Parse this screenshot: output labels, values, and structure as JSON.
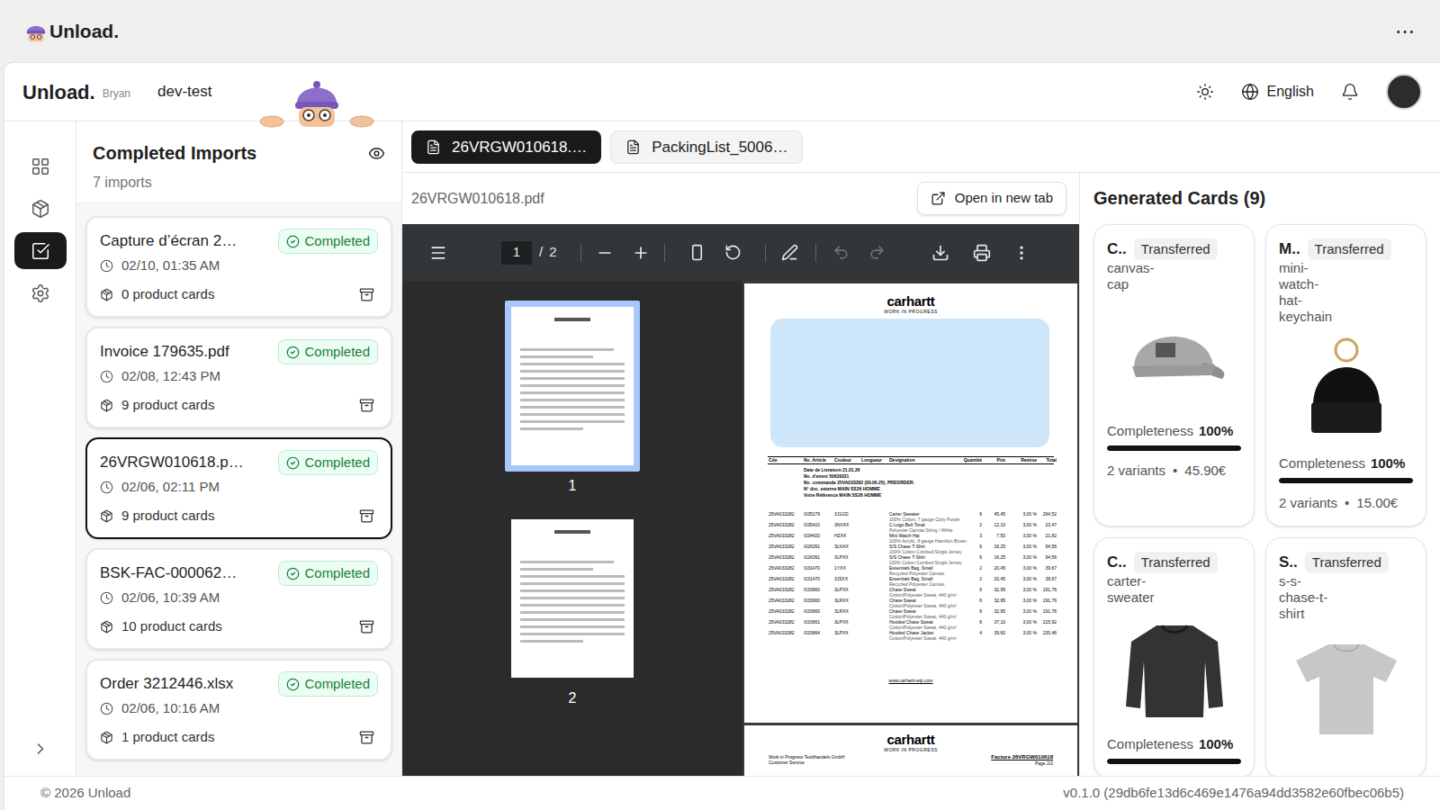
{
  "app_bar": {
    "title": "Unload.",
    "menu": "⋯"
  },
  "header": {
    "brand": "Unload.",
    "user": "Bryan",
    "workspace": "dev-test",
    "language": "English"
  },
  "nav_rail": {
    "items": [
      {
        "kind": "dashboard",
        "selected": false
      },
      {
        "kind": "products",
        "selected": false
      },
      {
        "kind": "imports",
        "selected": true
      },
      {
        "kind": "settings",
        "selected": false
      }
    ]
  },
  "imports_panel": {
    "title": "Completed Imports",
    "count": "7 imports",
    "items": [
      {
        "name": "Capture d’écran 2…",
        "status": "Completed",
        "time": "02/10, 01:35 AM",
        "cards": "0 product cards",
        "selected": false
      },
      {
        "name": "Invoice 179635.pdf",
        "status": "Completed",
        "time": "02/08, 12:43 PM",
        "cards": "9 product cards",
        "selected": false
      },
      {
        "name": "26VRGW010618.p…",
        "status": "Completed",
        "time": "02/06, 02:11 PM",
        "cards": "9 product cards",
        "selected": true
      },
      {
        "name": "BSK-FAC-000062…",
        "status": "Completed",
        "time": "02/06, 10:39 AM",
        "cards": "10 product cards",
        "selected": false
      },
      {
        "name": "Order 3212446.xlsx",
        "status": "Completed",
        "time": "02/06, 10:16 AM",
        "cards": "1 product cards",
        "selected": false
      }
    ]
  },
  "file_tabs": [
    {
      "label": "26VRGW010618.…",
      "selected": true
    },
    {
      "label": "PackingList_5006…",
      "selected": false
    }
  ],
  "document": {
    "filename": "26VRGW010618.pdf",
    "open_button": "Open in new tab"
  },
  "pdf_viewer": {
    "toolbar": {
      "page": "1",
      "separator": "/",
      "page_total": "2",
      "undo_disabled": true,
      "redo_disabled": true
    },
    "thumbnails": [
      {
        "label": "1",
        "selected": true
      },
      {
        "label": "2",
        "selected": false
      }
    ],
    "page1": {
      "logo": "carhartt",
      "tagline": "WORK IN PROGRESS",
      "columns": [
        "Cde",
        "No. Article",
        "Couleur",
        "Longueur",
        "Désignation",
        "Quantité",
        "Prix",
        "Remise",
        "Total"
      ],
      "info": [
        "Date de Livraison 21.01.26",
        "No. d'envoi 50629321",
        "No. commande 25VA033282 (30.06.25), PREORDER:",
        "N° doc. externe MAIN SS26 HOMME",
        "Votre Référence MAIN SS26 HOMME"
      ],
      "rows": [
        {
          "cells": [
            "25VA033282",
            "I035179",
            "3J1GD",
            "",
            "Carter Sweater",
            "6",
            "45,45",
            "3,00 %",
            "264,52"
          ],
          "detail": "100% Cotton, 7 gauge Cozy Purple"
        },
        {
          "cells": [
            "25VA033282",
            "I035410",
            "3NVXX",
            "",
            "C-Logo Belt Tonal",
            "2",
            "12,10",
            "3,00 %",
            "23,47"
          ],
          "detail": "Polyester Canvas String / White"
        },
        {
          "cells": [
            "25VA033282",
            "I034420",
            "HZXX",
            "",
            "Mini Watch Hat",
            "3",
            "7,50",
            "3,00 %",
            "21,82"
          ],
          "detail": "100% Acrylic, 8 gauge Hamilton Brown"
        },
        {
          "cells": [
            "25VA033282",
            "I026391",
            "3LNXX",
            "",
            "S/S Chase T-Shirt",
            "6",
            "16,25",
            "3,00 %",
            "94,56"
          ],
          "detail": "100% Cotton Combed Single Jersey"
        },
        {
          "cells": [
            "25VA033282",
            "I026391",
            "3LPXX",
            "",
            "S/S Chase T-Shirt",
            "6",
            "16,25",
            "3,00 %",
            "94,56"
          ],
          "detail": "100% Cotton Combed Single Jersey"
        },
        {
          "cells": [
            "25VA033282",
            "I031470",
            "1YXX",
            "",
            "Essentials Bag, Small",
            "2",
            "20,45",
            "3,00 %",
            "39,67"
          ],
          "detail": "Recycled Polyester Canvas"
        },
        {
          "cells": [
            "25VA033282",
            "I031470",
            "3JSXX",
            "",
            "Essentials Bag, Small",
            "2",
            "20,45",
            "3,00 %",
            "39,67"
          ],
          "detail": "Recycled Polyester Canvas"
        },
        {
          "cells": [
            "25VA033282",
            "I033660",
            "3LPXX",
            "",
            "Chase Sweat",
            "6",
            "32,95",
            "3,00 %",
            "191,76"
          ],
          "detail": "Cotton/Polyester Sweat, 440 g/m²"
        },
        {
          "cells": [
            "25VA033282",
            "I033660",
            "3LRXX",
            "",
            "Chase Sweat",
            "6",
            "32,95",
            "3,00 %",
            "191,76"
          ],
          "detail": "Cotton/Polyester Sweat, 440 g/m²"
        },
        {
          "cells": [
            "25VA033282",
            "I033660",
            "3LRXX",
            "",
            "Chase Sweat",
            "6",
            "32,95",
            "3,00 %",
            "191,76"
          ],
          "detail": "Cotton/Polyester Sweat, 440 g/m²"
        },
        {
          "cells": [
            "25VA033282",
            "I033661",
            "3LPXX",
            "",
            "Hooded Chase Sweat",
            "6",
            "37,10",
            "3,00 %",
            "215,92"
          ],
          "detail": "Cotton/Polyester Sweat, 440 g/m²"
        },
        {
          "cells": [
            "25VA033282",
            "I033664",
            "3LPXX",
            "",
            "Hooded Chase Jacket",
            "4",
            "39,60",
            "3,00 %",
            "230,46"
          ],
          "detail": "Cotton/Polyester Sweat, 440 g/m²"
        }
      ],
      "footer": "www.carhartt-wip.com"
    },
    "page2": {
      "logo": "carhartt",
      "tagline": "WORK IN PROGRESS",
      "left_lines": [
        "Work in Progress Textilhandels GmbH",
        "Customer Service"
      ],
      "invoice": "Facture 26VRGW010618",
      "page_label": "Page 2/2"
    }
  },
  "cards_panel": {
    "title": "Generated Cards (9)",
    "cards": [
      {
        "title": "C..",
        "status": "Transferred",
        "handle": "canvas-cap",
        "kind": "cap",
        "completeness_label": "Completeness",
        "completeness": "100%",
        "level": 1,
        "variants": "2 variants",
        "separator": "•",
        "price": "45.90€"
      },
      {
        "title": "M..",
        "status": "Transferred",
        "handle": "mini-watch-hat-keychain",
        "kind": "beanie",
        "completeness_label": "Completeness",
        "completeness": "100%",
        "level": 1,
        "variants": "2 variants",
        "separator": "•",
        "price": "15.00€"
      },
      {
        "title": "C..",
        "status": "Transferred",
        "handle": "carter-sweater",
        "kind": "sweater",
        "completeness_label": "Completeness",
        "completeness": "100%",
        "level": 1
      },
      {
        "title": "S..",
        "status": "Transferred",
        "handle": "s-s-chase-t-shirt",
        "kind": "tshirt"
      }
    ]
  },
  "footer": {
    "copyright": "© 2026 Unload",
    "version": "v0.1.0 (29db6fe13d6c469e1476a94dd3582e60fbec06b5)"
  }
}
